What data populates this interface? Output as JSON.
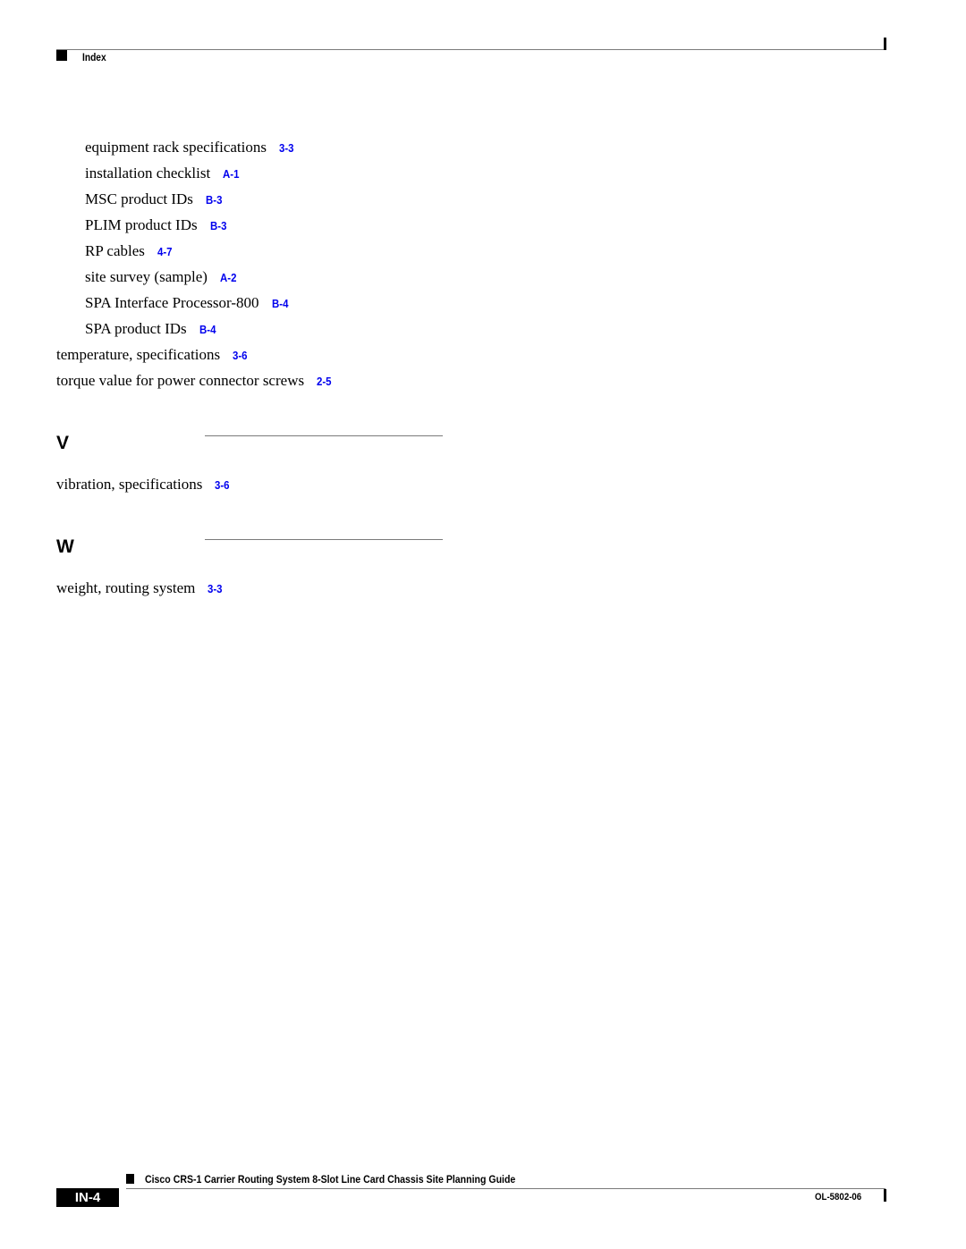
{
  "header": {
    "section_label": "Index"
  },
  "entries_top": [
    {
      "text": "equipment rack specifications",
      "ref": "3-3",
      "level": 2
    },
    {
      "text": "installation checklist",
      "ref": "A-1",
      "level": 2
    },
    {
      "text": "MSC product IDs",
      "ref": "B-3",
      "level": 2
    },
    {
      "text": "PLIM product IDs",
      "ref": "B-3",
      "level": 2
    },
    {
      "text": "RP cables",
      "ref": "4-7",
      "level": 2
    },
    {
      "text": "site survey (sample)",
      "ref": "A-2",
      "level": 2
    },
    {
      "text": "SPA Interface Processor-800",
      "ref": "B-4",
      "level": 2
    },
    {
      "text": "SPA product IDs",
      "ref": "B-4",
      "level": 2
    },
    {
      "text": "temperature, specifications",
      "ref": "3-6",
      "level": 1
    },
    {
      "text": "torque value for power connector screws",
      "ref": "2-5",
      "level": 1
    }
  ],
  "sections": [
    {
      "letter": "V",
      "entries": [
        {
          "text": "vibration, specifications",
          "ref": "3-6"
        }
      ]
    },
    {
      "letter": "W",
      "entries": [
        {
          "text": "weight, routing system",
          "ref": "3-3"
        }
      ]
    }
  ],
  "footer": {
    "title": "Cisco CRS-1 Carrier Routing System 8-Slot Line Card Chassis Site Planning Guide",
    "page_number": "IN-4",
    "doc_number": "OL-5802-06"
  },
  "colors": {
    "link": "#0000ee",
    "text": "#000000",
    "rule": "#7a7a7a"
  }
}
